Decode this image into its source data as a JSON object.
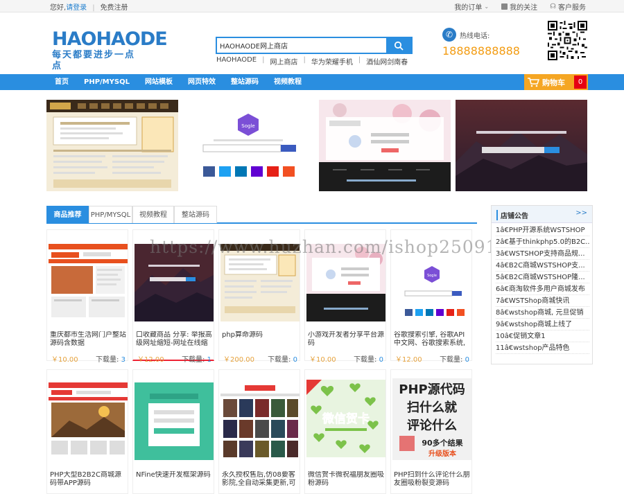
{
  "topbar": {
    "greeting": "您好,",
    "login": "请登录",
    "register": "免费注册",
    "my_orders": "我的订单",
    "my_follows": "我的关注",
    "customer_service": "客户服务"
  },
  "logo": {
    "line1": "HAOHAODE",
    "line2": "每天都要进步一点点"
  },
  "search": {
    "value": "HAOHAODE网上商店",
    "hot_words": [
      "HAOHAODE",
      "网上商店",
      "华为荣耀手机",
      "酒仙网剑南春"
    ]
  },
  "hotline": {
    "label": "热线电话:",
    "number": "18888888888"
  },
  "nav": {
    "items": [
      "首页",
      "PHP/MYSQL",
      "网站模板",
      "网页特效",
      "整站源码",
      "视频教程"
    ]
  },
  "cart": {
    "label": "购物车",
    "count": "0"
  },
  "colors": {
    "primary": "#2a8ee0",
    "cart": "#f5a623",
    "price": "#e6a23c",
    "badge": "#e60012"
  },
  "tabs": [
    "商品推荐",
    "PHP/MYSQL",
    "视频教程",
    "整站源码"
  ],
  "watermark": "https://www.huzhan.com/ishop25091",
  "products": [
    {
      "name": "重庆都市生活网门户整站源码含数据",
      "price": "￥10.00",
      "downloads_label": "下载量:",
      "downloads": "3"
    },
    {
      "name": "口收藏商品 分享: 举报高级网址缩短-网址在线缩",
      "price": "￥12.00",
      "downloads_label": "下载量:",
      "downloads": "1"
    },
    {
      "name": "php算命源码",
      "price": "￥200.00",
      "downloads_label": "下载量:",
      "downloads": "0"
    },
    {
      "name": "小游戏开发者分享平台源码",
      "price": "￥10.00",
      "downloads_label": "下载量:",
      "downloads": "0"
    },
    {
      "name": "谷歌搜索引擎, 谷歌API中文网、谷歌搜索系统,",
      "price": "￥12.00",
      "downloads_label": "下载量:",
      "downloads": "0"
    },
    {
      "name": "PHP大型B2B2C商城源码带APP源码"
    },
    {
      "name": "NFine快速开发框架源码"
    },
    {
      "name": "永久授权售后,仿08要客影院,全自动采集更新,可"
    },
    {
      "name": "微信贺卡微祝福朋友圈吸粉源码"
    },
    {
      "name": "PHP扫到什么评论什么朋友圈吸粉裂变源码"
    }
  ],
  "thumb_text": {
    "sogle": "Sogle",
    "wechat_card": "微信贺卡",
    "php_line1": "PHP源代码",
    "php_line2": "扫什么就",
    "php_line3": "评论什么",
    "php_line4": "90多个结果",
    "php_line5": "升级版本"
  },
  "notice": {
    "title": "店铺公告",
    "more": ">>",
    "items": [
      "1â€PHP开源系统WSTSHOP",
      "2â€基于thinkphp5.0的B2C...",
      "3â€WSTSHOP支持商品规...",
      "4â€B2C商城WSTSHOP支...",
      "5â€B2C商城WSTSHOP隆...",
      "6â€商淘软件多用户商城发布",
      "7â€WSTShop商城快讯",
      "8â€wstshop商城, 元旦促销",
      "9â€wstshop商城上线了",
      "10â€促销文章1",
      "11â€wstshop产品特色"
    ]
  }
}
